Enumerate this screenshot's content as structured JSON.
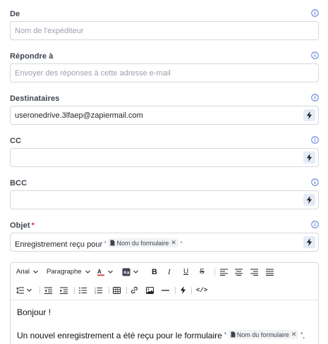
{
  "fields": {
    "from": {
      "label": "De",
      "placeholder": "Nom de l'expéditeur",
      "value": ""
    },
    "reply_to": {
      "label": "Répondre à",
      "placeholder": "Envoyer des réponses à cette adresse e-mail",
      "value": ""
    },
    "recipients": {
      "label": "Destinataires",
      "value": "useronedrive.3lfaep@zapiermail.com"
    },
    "cc": {
      "label": "CC",
      "value": ""
    },
    "bcc": {
      "label": "BCC",
      "value": ""
    },
    "subject": {
      "label": "Objet",
      "required_mark": "*",
      "prefix": "Enregistrement reçu pour '",
      "pill": "Nom du formulaire",
      "suffix": "'"
    }
  },
  "toolbar": {
    "font": "Arial",
    "paragraph": "Paragraphe",
    "bold": "B",
    "italic": "I",
    "underline": "U",
    "strike": "S",
    "code": "</>"
  },
  "editor": {
    "greeting": "Bonjour !",
    "line2_prefix": "Un nouvel enregistrement a été reçu pour le formulaire '",
    "line2_pill": "Nom du formulaire",
    "line2_suffix": "'."
  },
  "colors": {
    "accent_bg": "#e6ebf8",
    "info": "#4a6fd3",
    "required": "#d43a3a"
  }
}
